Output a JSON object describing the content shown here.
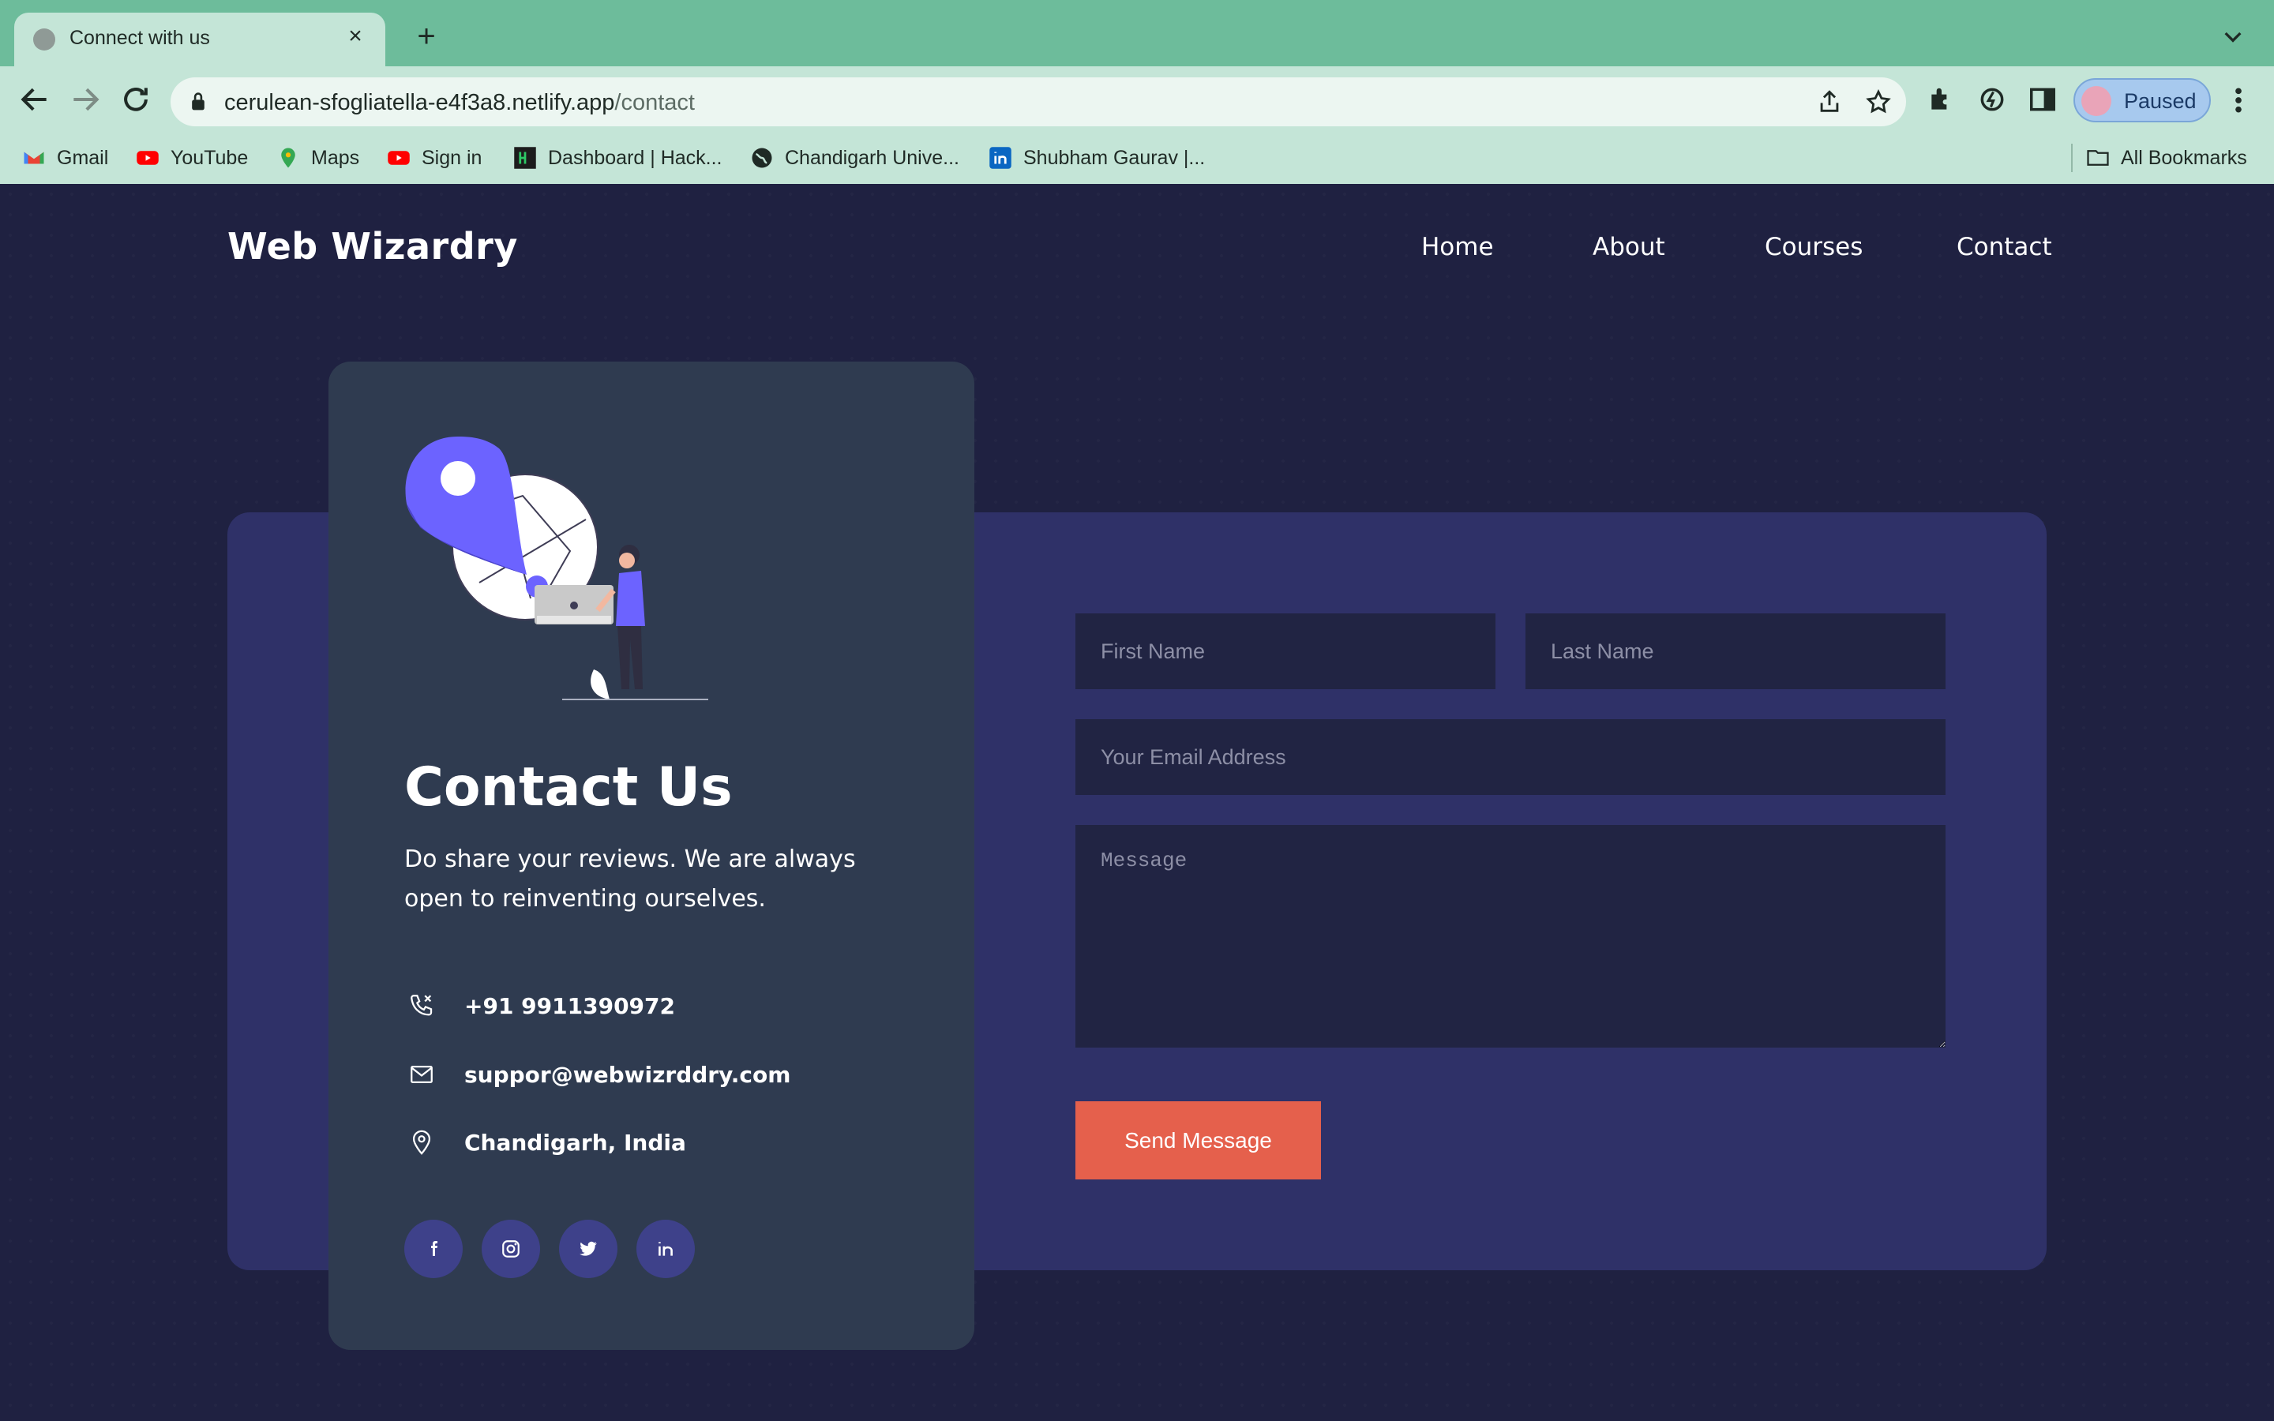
{
  "browser": {
    "tab_title": "Connect with us",
    "tab_close": "×",
    "new_tab": "+",
    "url_host": "cerulean-sfogliatella-e4f3a8.netlify.app",
    "url_path": "/contact",
    "profile_label": "Paused",
    "bookmarks": [
      "Gmail",
      "YouTube",
      "Maps",
      "Sign in",
      "Dashboard | Hack...",
      "Chandigarh Unive...",
      "Shubham Gaurav |..."
    ],
    "all_bookmarks": "All Bookmarks"
  },
  "site": {
    "brand": "Web Wizardry",
    "nav": [
      "Home",
      "About",
      "Courses",
      "Contact"
    ]
  },
  "contact": {
    "title": "Contact Us",
    "description": "Do share your reviews. We are always open to reinventing ourselves.",
    "phone": "+91 9911390972",
    "email": "suppor@webwizrddry.com",
    "location": "Chandigarh, India",
    "socials": [
      "facebook-icon",
      "instagram-icon",
      "twitter-icon",
      "linkedin-icon"
    ]
  },
  "form": {
    "first_name_placeholder": "First Name",
    "last_name_placeholder": "Last Name",
    "email_placeholder": "Your Email Address",
    "message_placeholder": "Message",
    "submit_label": "Send Message"
  },
  "colors": {
    "page_bg": "#1f2141",
    "panel_bg": "#2f3168",
    "card_bg": "#2f3b50",
    "field_bg": "#212443",
    "accent": "#e5604c",
    "illustration_purple": "#6c63ff"
  }
}
